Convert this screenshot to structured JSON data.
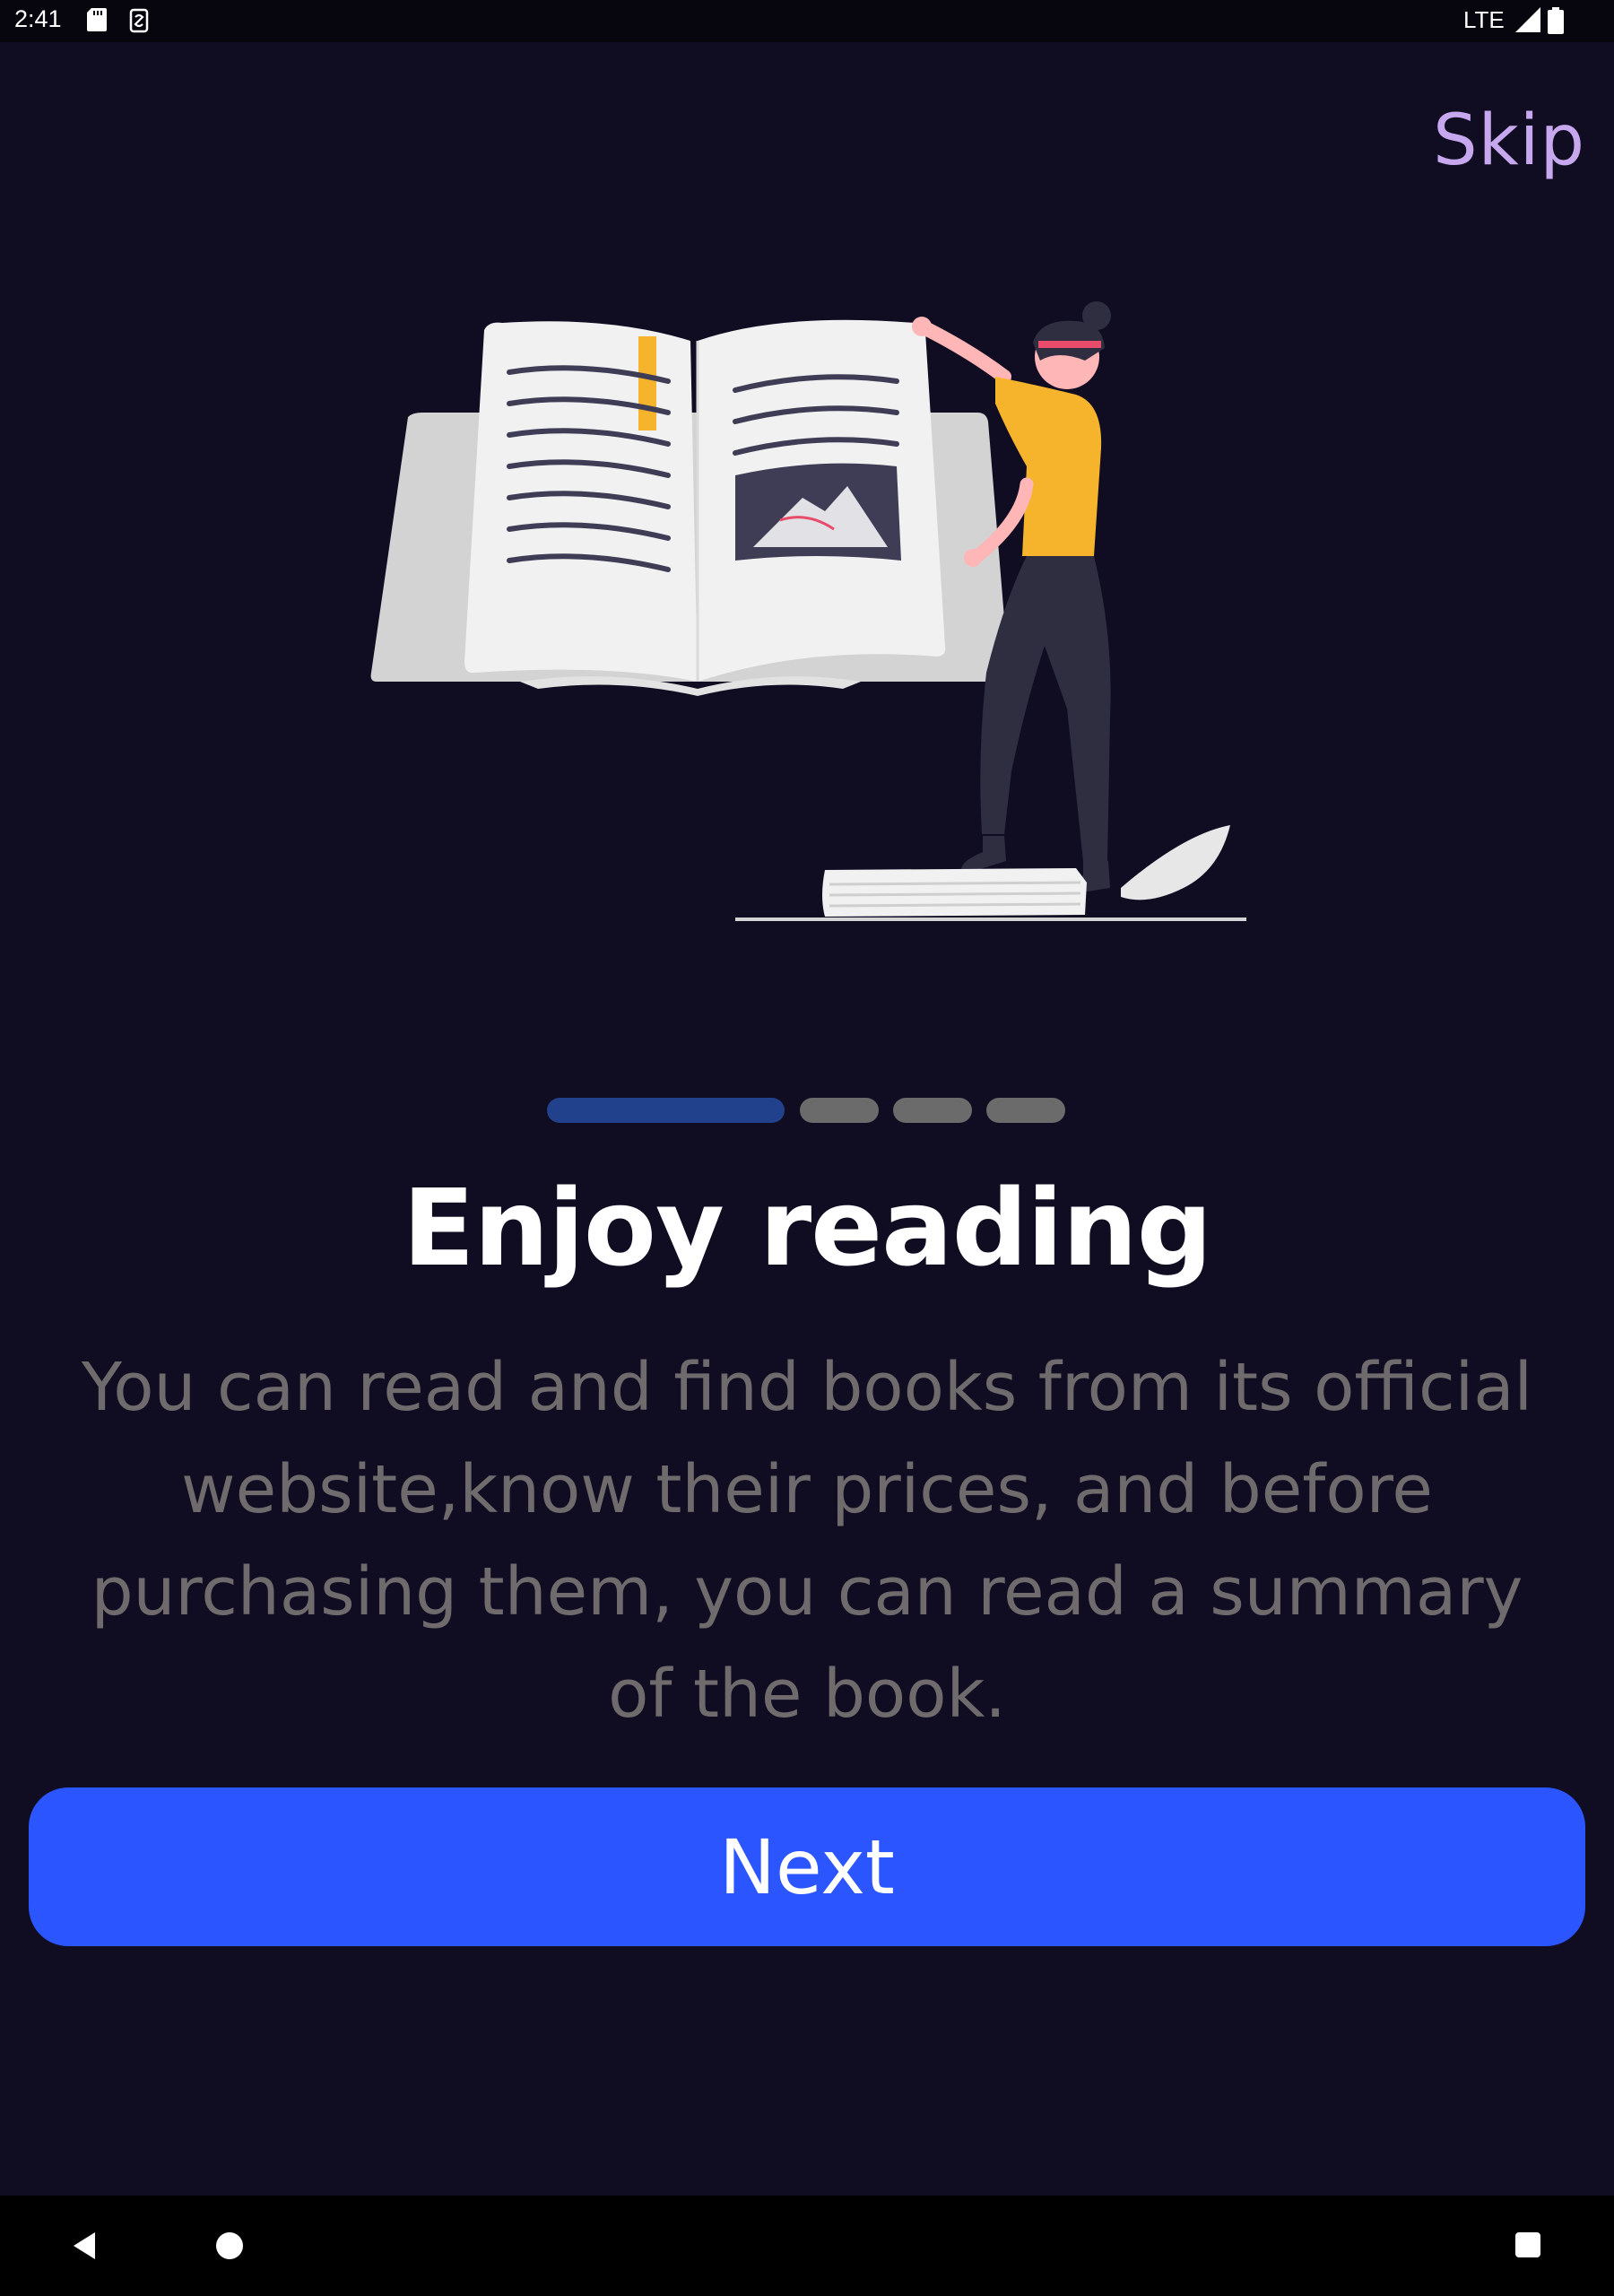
{
  "status_bar": {
    "time": "2:41",
    "network": "LTE",
    "icons": [
      "sd-card-icon",
      "sim-icon",
      "signal-icon",
      "battery-icon"
    ]
  },
  "skip_label": "Skip",
  "illustration": {
    "name": "woman-with-open-book-illustration"
  },
  "indicator": {
    "total": 4,
    "active_index": 0
  },
  "title": "Enjoy reading",
  "description": "You can read and find books from its official website,know their prices, and before purchasing them, you can read a summary of the book.",
  "next_label": "Next",
  "nav_bar": {
    "icons": [
      "back-icon",
      "home-icon",
      "recents-icon"
    ]
  },
  "colors": {
    "background": "#100c22",
    "skip": "#c7a8ee",
    "indicator_active": "#21418c",
    "indicator_inactive": "#6b6b6b",
    "button": "#2b55fe",
    "description": "#6f6b6d",
    "accent_yellow": "#f6b32c"
  }
}
